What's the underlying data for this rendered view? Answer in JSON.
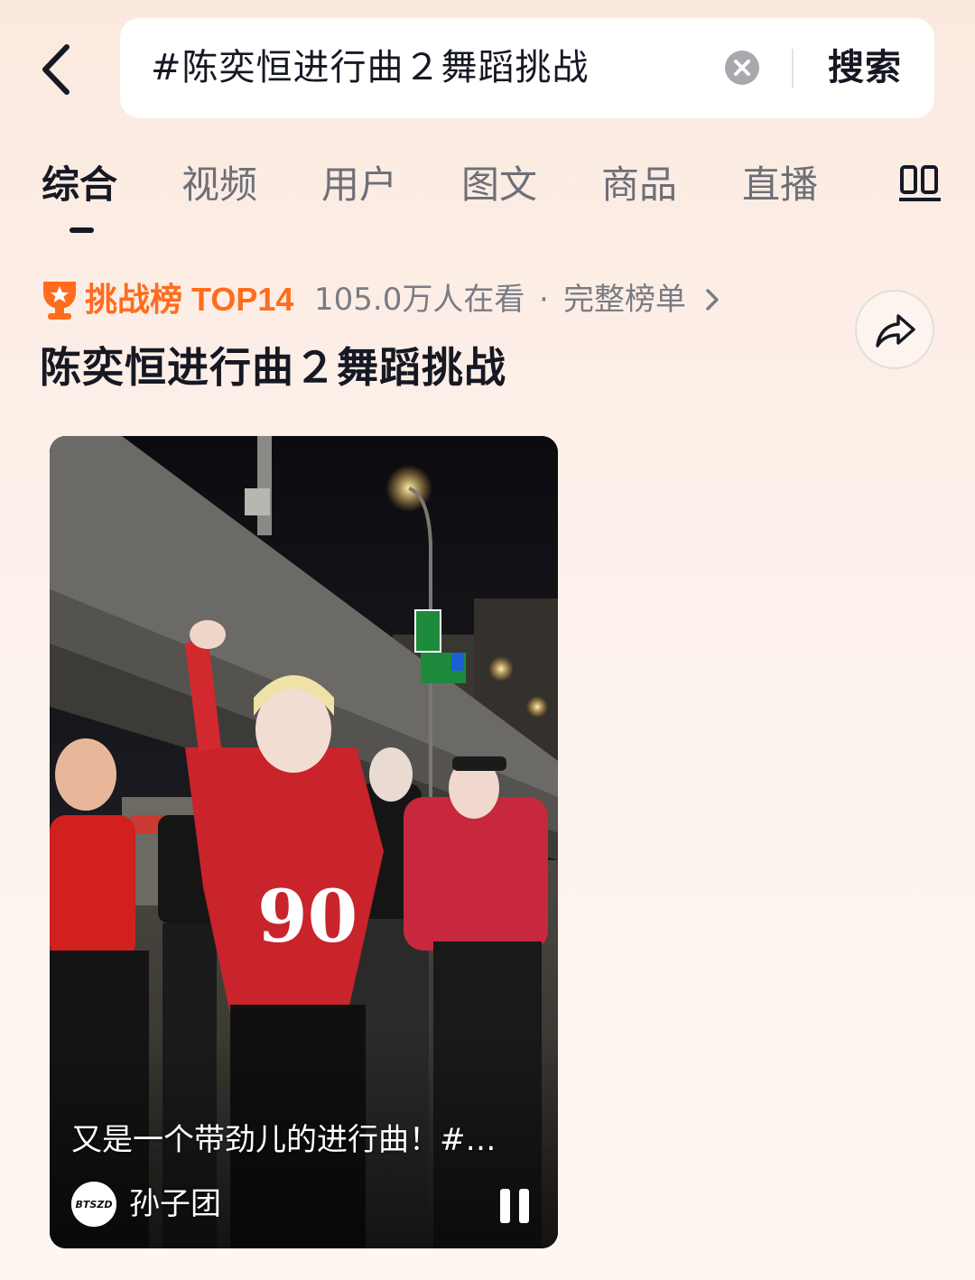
{
  "search": {
    "query": "#陈奕恒进行曲２舞蹈挑战",
    "button_label": "搜索"
  },
  "tabs": [
    {
      "label": "综合",
      "active": true
    },
    {
      "label": "视频",
      "active": false
    },
    {
      "label": "用户",
      "active": false
    },
    {
      "label": "图文",
      "active": false
    },
    {
      "label": "商品",
      "active": false
    },
    {
      "label": "直播",
      "active": false
    }
  ],
  "challenge": {
    "rank_label": "挑战榜 TOP14",
    "viewers": "105.0万人在看",
    "separator": "·",
    "full_list": "完整榜单",
    "title": "陈奕恒进行曲２舞蹈挑战"
  },
  "video": {
    "caption": "又是一个带劲儿的进行曲！#…",
    "author": "孙子团",
    "avatar_logo_text": "BTSZD"
  },
  "colors": {
    "rank_accent": "#ff6c1e",
    "text_primary": "#161823",
    "text_secondary": "#7a7c84"
  },
  "icons": [
    "chevron-left-icon",
    "clear-icon",
    "filter-icon",
    "trophy-icon",
    "chevron-right-icon",
    "share-icon",
    "pause-icon"
  ]
}
